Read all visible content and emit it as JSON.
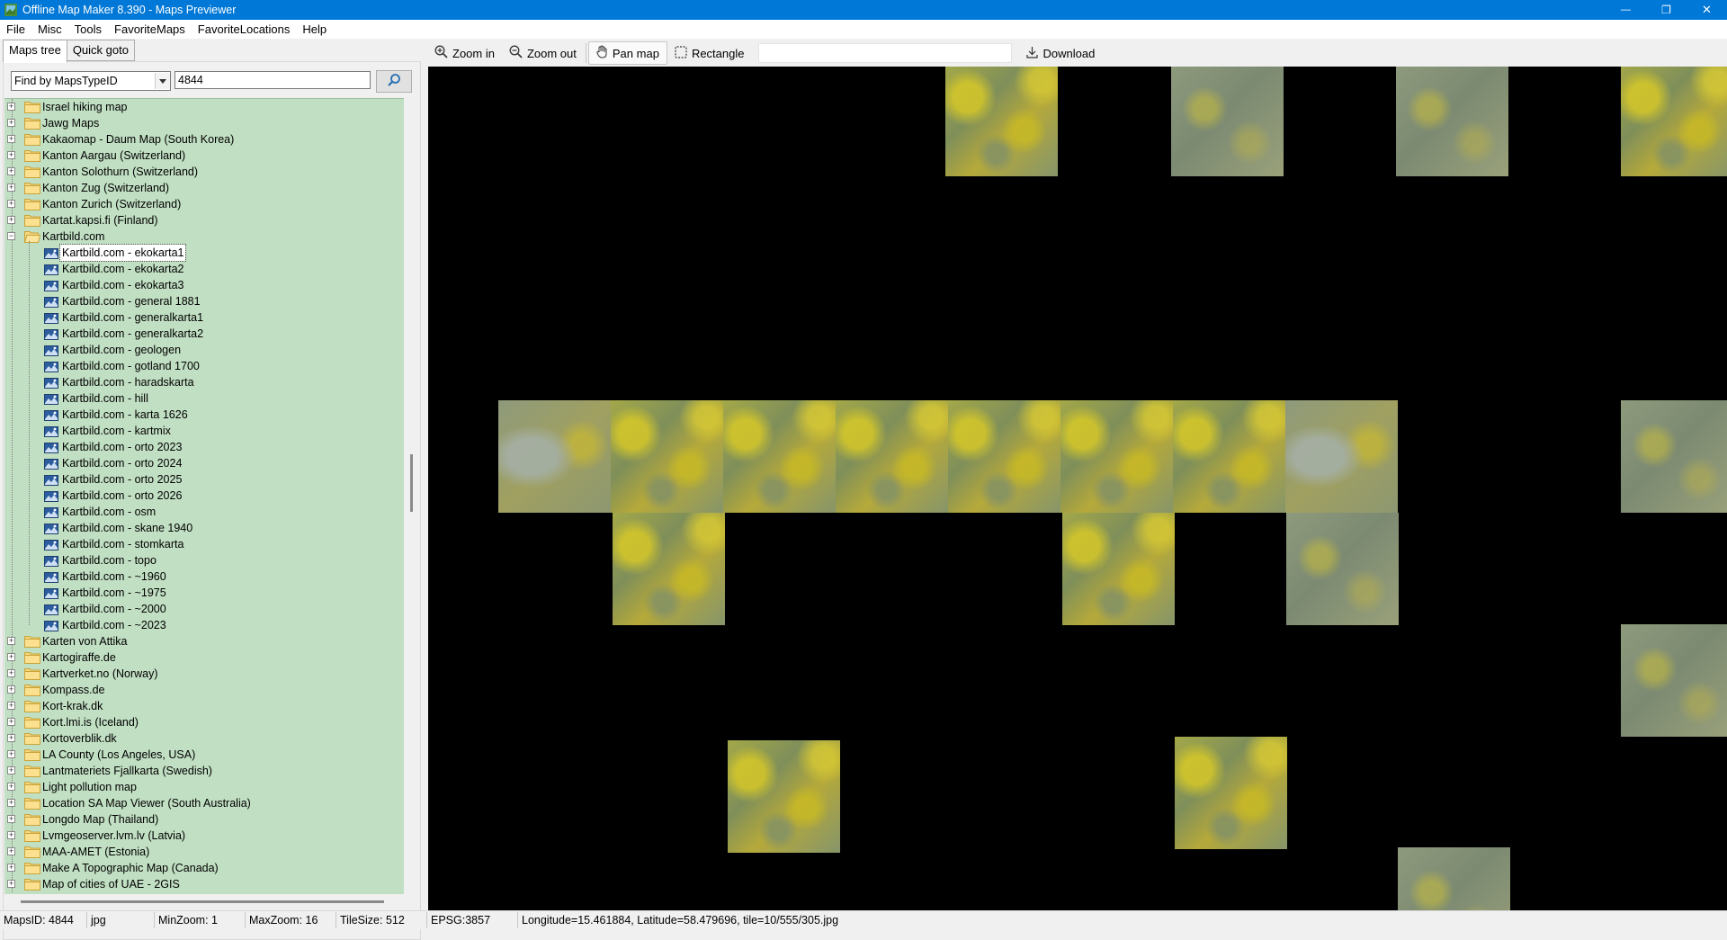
{
  "window": {
    "title": "Offline Map Maker 8.390 - Maps Previewer",
    "minimize_label": "—",
    "maximize_label": "❐",
    "close_label": "✕"
  },
  "menu": [
    "File",
    "Misc",
    "Tools",
    "FavoriteMaps",
    "FavoriteLocations",
    "Help"
  ],
  "tabs": [
    "Maps tree",
    "Quick goto"
  ],
  "search": {
    "mode": "Find by MapsTypeID",
    "value": "4844"
  },
  "tree": {
    "parents_before": [
      "Israel hiking map",
      "Jawg Maps",
      "Kakaomap - Daum Map (South Korea)",
      "Kanton Aargau (Switzerland)",
      "Kanton Solothurn (Switzerland)",
      "Kanton Zug (Switzerland)",
      "Kanton Zurich (Switzerland)",
      "Kartat.kapsi.fi (Finland)"
    ],
    "expanded_parent": "Kartbild.com",
    "children": [
      "Kartbild.com - ekokarta1",
      "Kartbild.com - ekokarta2",
      "Kartbild.com - ekokarta3",
      "Kartbild.com - general 1881",
      "Kartbild.com - generalkarta1",
      "Kartbild.com - generalkarta2",
      "Kartbild.com - geologen",
      "Kartbild.com - gotland 1700",
      "Kartbild.com - haradskarta",
      "Kartbild.com - hill",
      "Kartbild.com - karta 1626",
      "Kartbild.com - kartmix",
      "Kartbild.com - orto 2023",
      "Kartbild.com - orto 2024",
      "Kartbild.com - orto 2025",
      "Kartbild.com - orto 2026",
      "Kartbild.com - osm",
      "Kartbild.com - skane 1940",
      "Kartbild.com - stomkarta",
      "Kartbild.com - topo",
      "Kartbild.com - ~1960",
      "Kartbild.com - ~1975",
      "Kartbild.com - ~2000",
      "Kartbild.com - ~2023"
    ],
    "selected_index": 0,
    "parents_after": [
      "Karten von Attika",
      "Kartogiraffe.de",
      "Kartverket.no (Norway)",
      "Kompass.de",
      "Kort-krak.dk",
      "Kort.lmi.is (Iceland)",
      "Kortoverblik.dk",
      "LA County (Los Angeles, USA)",
      "Lantmateriets Fjallkarta (Swedish)",
      "Light pollution map",
      "Location SA Map Viewer (South Australia)",
      "Longdo Map (Thailand)",
      "Lvmgeoserver.lvm.lv (Latvia)",
      "MAA-AMET (Estonia)",
      "Make A Topographic Map (Canada)",
      "Map of cities of UAE - 2GIS"
    ]
  },
  "toolbar": {
    "zoom_in": "Zoom in",
    "zoom_out": "Zoom out",
    "pan_map": "Pan map",
    "rectangle": "Rectangle",
    "download": "Download"
  },
  "status": {
    "maps_id": "MapsID: 4844",
    "format": "jpg",
    "min_zoom": "MinZoom: 1",
    "max_zoom": "MaxZoom: 16",
    "tile_size": "TileSize: 512",
    "epsg": "EPSG:3857",
    "coords": "Longitude=15.461884, Latitude=58.479696, tile=10/555/305.jpg"
  },
  "colors": {
    "titlebar": "#0078d7",
    "tree_background": "#c1dfc3",
    "map_background": "#000000"
  }
}
